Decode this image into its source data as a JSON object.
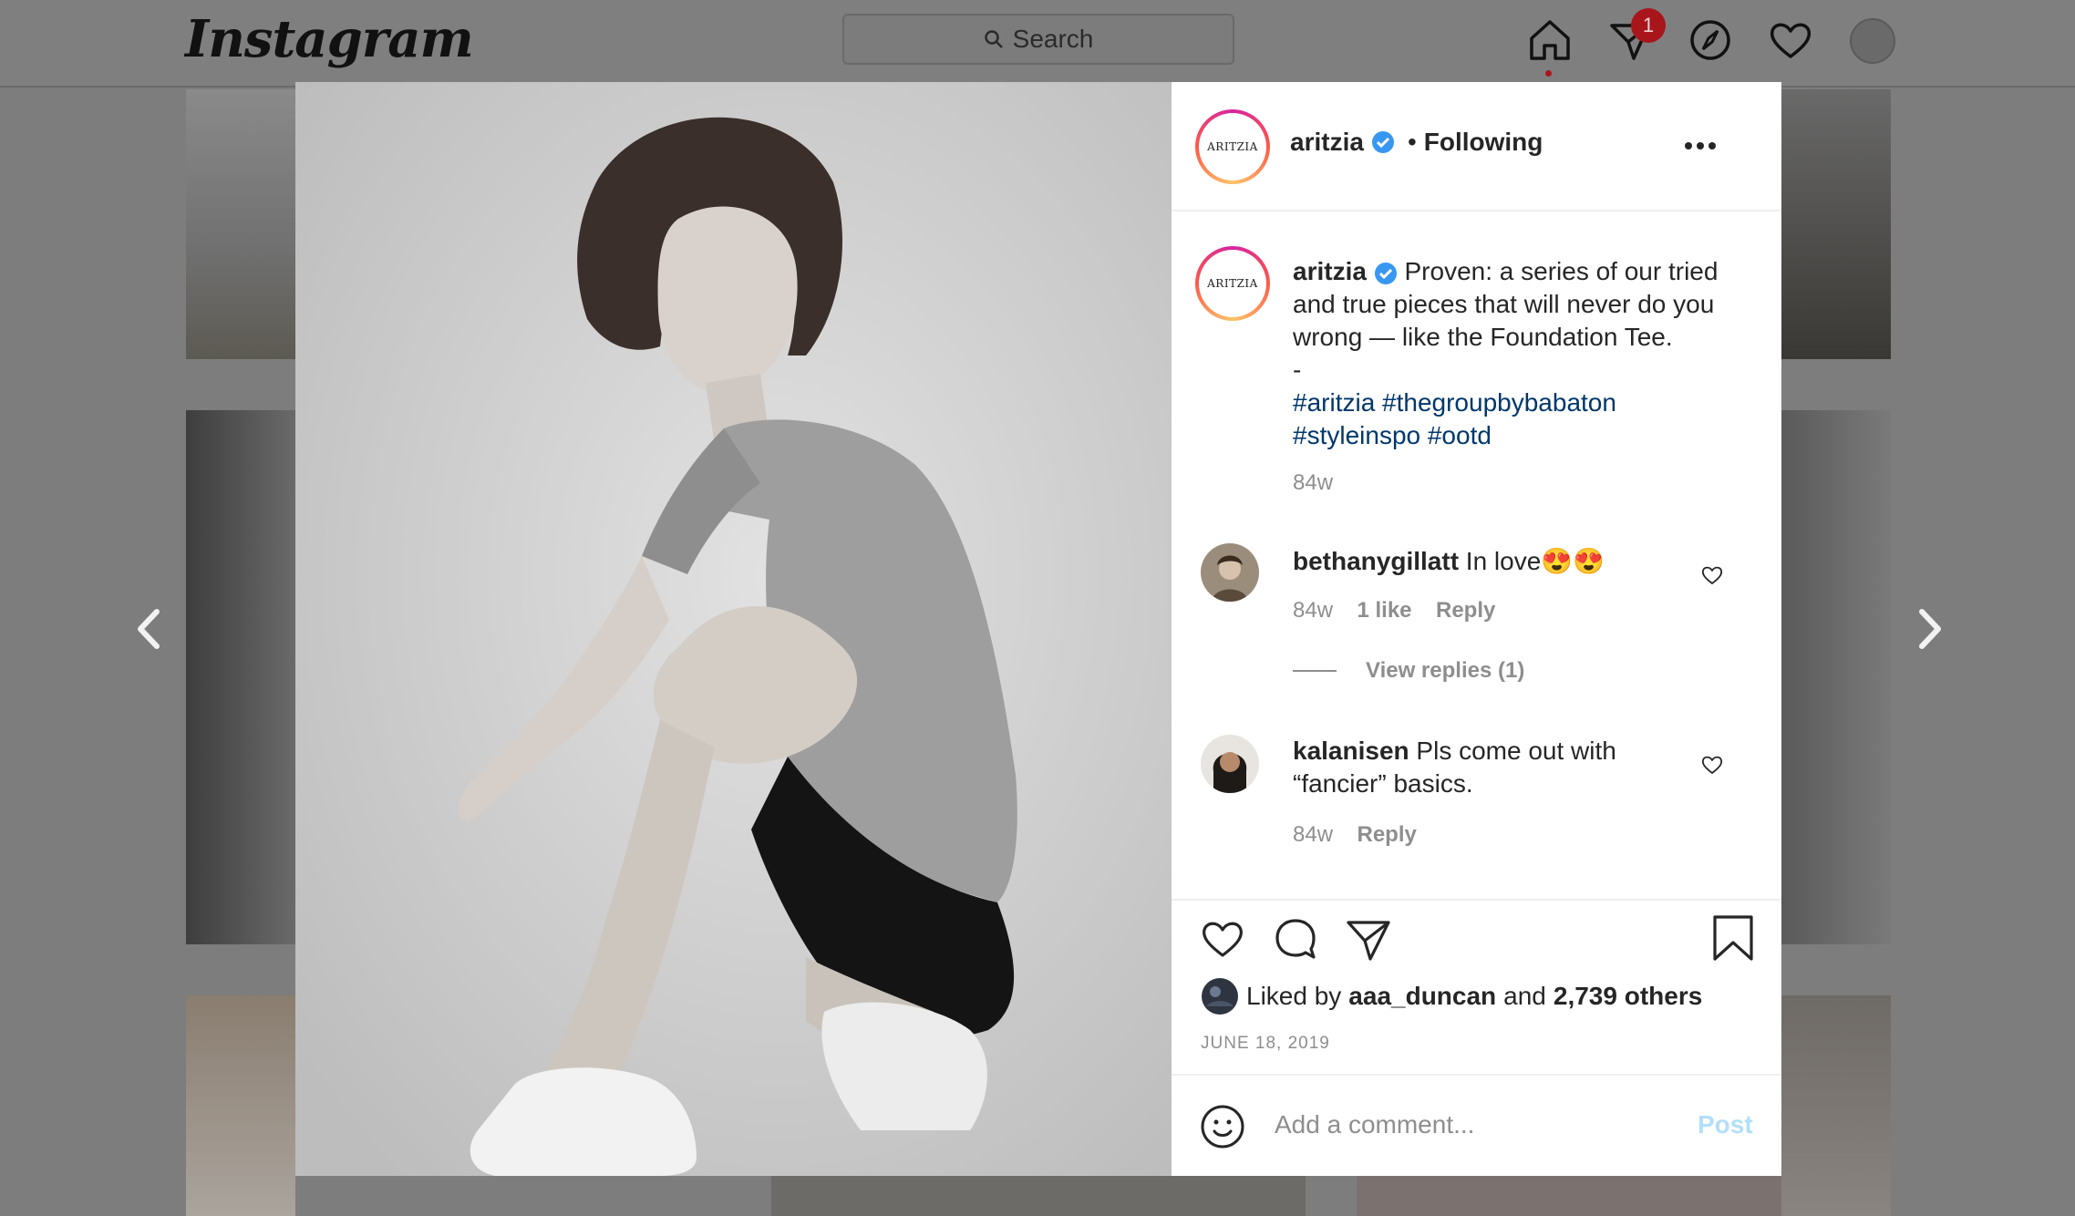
{
  "nav": {
    "logo": "Instagram",
    "search_placeholder": "Search",
    "notification_count": "1",
    "icons": [
      "home-icon",
      "direct-message-icon",
      "explore-icon",
      "activity-heart-icon",
      "profile-avatar"
    ]
  },
  "post": {
    "account": "aritzia",
    "account_logo_text": "ARITZIA",
    "follow_status": "Following",
    "caption": {
      "username": "aritzia",
      "lines": [
        "Proven: a series of our tried",
        "and true pieces that will never do you",
        "wrong — like the Foundation Tee.",
        "-"
      ],
      "hashtags_line1": "#aritzia #thegroupbybabaton",
      "hashtags_line2": "#styleinspo #ootd",
      "time": "84w"
    },
    "comments": [
      {
        "username": "bethanygillatt",
        "text": "In love😍😍",
        "time": "84w",
        "likes": "1 like",
        "reply": "Reply",
        "view_replies": "View replies (1)"
      },
      {
        "username": "kalanisen",
        "text_line1": "Pls come out with",
        "text_line2": "“fancier” basics.",
        "time": "84w",
        "reply": "Reply"
      }
    ],
    "liked_by_prefix": "Liked by",
    "liked_by_user": "aaa_duncan",
    "liked_by_and": "and",
    "liked_by_others": "2,739 others",
    "date": "JUNE 18, 2019",
    "comment_placeholder": "Add a comment...",
    "post_button": "Post"
  },
  "colors": {
    "link": "#00376b",
    "muted": "#8e8e8e",
    "verified": "#3897f0",
    "post_disabled": "#b2dffc",
    "badge": "#a8161c"
  }
}
